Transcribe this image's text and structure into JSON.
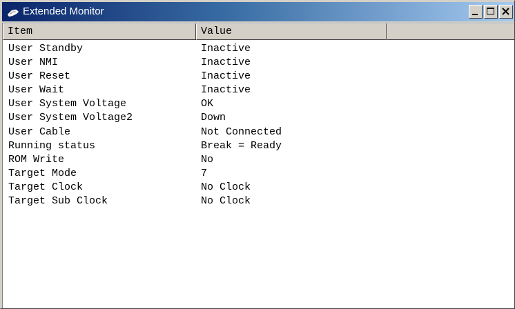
{
  "window": {
    "title": "Extended Monitor",
    "icon": "monitor-app-icon",
    "colors": {
      "titlebar_start": "#0a246a",
      "titlebar_end": "#a6caf0",
      "face": "#d4d0c8"
    }
  },
  "titlebar_buttons": {
    "minimize": "minimize-icon",
    "maximize": "maximize-icon",
    "close": "close-icon"
  },
  "table": {
    "columns": [
      "Item",
      "Value",
      ""
    ],
    "rows": [
      {
        "item": "User Standby",
        "value": "Inactive"
      },
      {
        "item": "User NMI",
        "value": "Inactive"
      },
      {
        "item": "User Reset",
        "value": "Inactive"
      },
      {
        "item": "User Wait",
        "value": "Inactive"
      },
      {
        "item": "User System Voltage",
        "value": "OK"
      },
      {
        "item": "User System Voltage2",
        "value": "Down"
      },
      {
        "item": "User Cable",
        "value": "Not Connected"
      },
      {
        "item": "Running status",
        "value": "Break = Ready"
      },
      {
        "item": "ROM Write",
        "value": "No"
      },
      {
        "item": "Target Mode",
        "value": "7"
      },
      {
        "item": "Target Clock",
        "value": "No Clock"
      },
      {
        "item": "Target Sub Clock",
        "value": "No Clock"
      }
    ]
  }
}
